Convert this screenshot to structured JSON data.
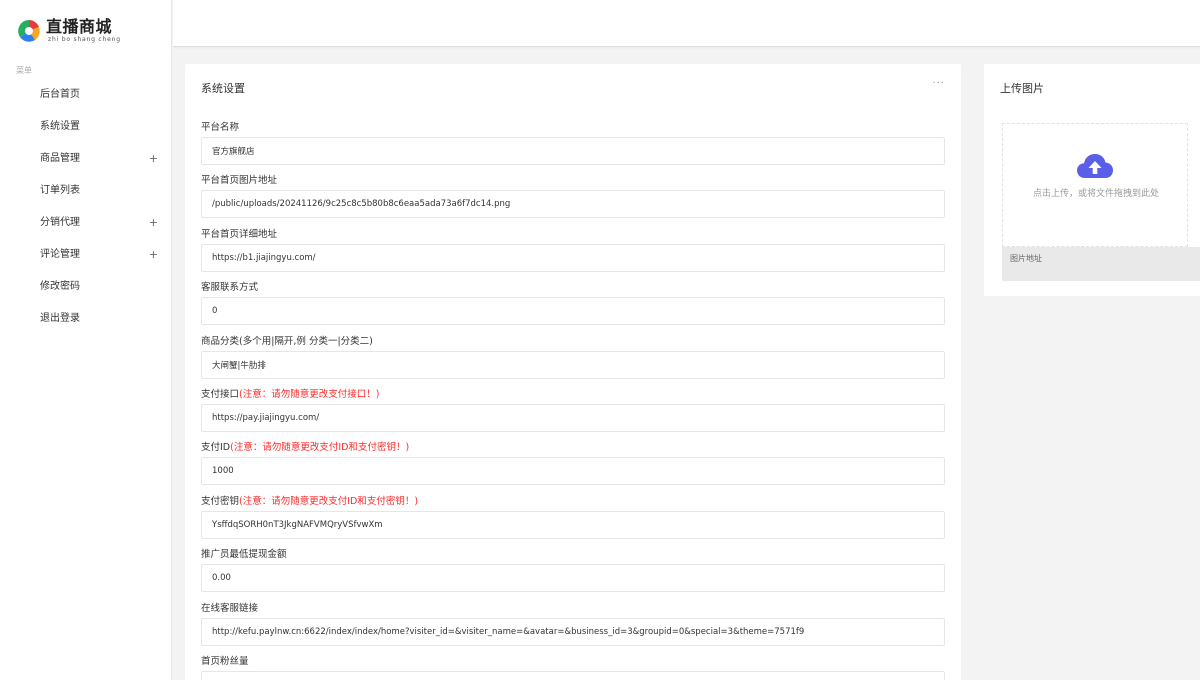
{
  "brand": {
    "name_cn": "直播商城",
    "name_en": "zhi bo shang cheng",
    "colors": [
      "#e63c3c",
      "#f5a623",
      "#2f80ed",
      "#27ae60"
    ]
  },
  "sidebar": {
    "caption": "菜单",
    "items": [
      {
        "label": "后台首页",
        "expandable": false
      },
      {
        "label": "系统设置",
        "expandable": false
      },
      {
        "label": "商品管理",
        "expandable": true,
        "icon": "+"
      },
      {
        "label": "订单列表",
        "expandable": false
      },
      {
        "label": "分销代理",
        "expandable": true,
        "icon": "+"
      },
      {
        "label": "评论管理",
        "expandable": true,
        "icon": "+"
      },
      {
        "label": "修改密码",
        "expandable": false
      },
      {
        "label": "退出登录",
        "expandable": false
      }
    ]
  },
  "settings": {
    "title": "系统设置",
    "more_icon": "···",
    "fields": [
      {
        "label": "平台名称",
        "warn": "",
        "value": "官方旗舰店"
      },
      {
        "label": "平台首页图片地址",
        "warn": "",
        "value": "/public/uploads/20241126/9c25c8c5b80b8c6eaa5ada73a6f7dc14.png"
      },
      {
        "label": "平台首页详细地址",
        "warn": "",
        "value": "https://b1.jiajingyu.com/"
      },
      {
        "label": "客服联系方式",
        "warn": "",
        "value": "0"
      },
      {
        "label": "商品分类(多个用|隔开,例 分类一|分类二)",
        "warn": "",
        "value": "大闸蟹|牛肋排"
      },
      {
        "label": "支付接口",
        "warn": "(注意：请勿随意更改支付接口！)",
        "value": "https://pay.jiajingyu.com/"
      },
      {
        "label": "支付ID",
        "warn": "(注意：请勿随意更改支付ID和支付密钥！)",
        "value": "1000"
      },
      {
        "label": "支付密钥",
        "warn": "(注意：请勿随意更改支付ID和支付密钥！)",
        "value": "YsffdqSORH0nT3JkgNAFVMQryVSfvwXm"
      },
      {
        "label": "推广员最低提现金额",
        "warn": "",
        "value": "0.00"
      },
      {
        "label": "在线客服链接",
        "warn": "",
        "value": "http://kefu.paylnw.cn:6622/index/index/home?visiter_id=&visiter_name=&avatar=&business_id=3&groupid=0&special=3&theme=7571f9"
      },
      {
        "label": "首页粉丝量",
        "warn": "",
        "value": ""
      }
    ]
  },
  "upload": {
    "title": "上传图片",
    "hint": "点击上传，或将文件拖拽到此处",
    "address_label": "图片地址",
    "icon": "cloud-upload-icon",
    "icon_color": "#5b5fe8"
  }
}
